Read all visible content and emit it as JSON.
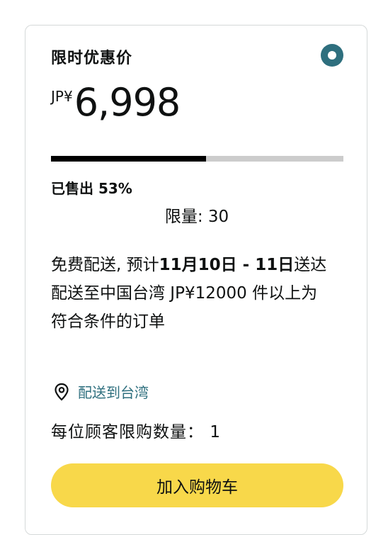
{
  "offer": {
    "title": "限时优惠价",
    "selected": true,
    "currency": "JP¥",
    "price": "6,998",
    "sold_percent": 53,
    "sold_label": "已售出 53%",
    "limit_label": "限量: 30"
  },
  "delivery": {
    "prefix": "免费配送, 预计",
    "date_range": "11月10日 - 11日",
    "suffix": "送达 配送至中国台湾 JP¥12000 件以上为 符合条件的订单"
  },
  "location": {
    "icon": "location-pin-icon",
    "label": "配送到台湾"
  },
  "quantity": {
    "label": "每位顾客限购数量：",
    "value": "1"
  },
  "cart_button": {
    "label": "加入购物车"
  },
  "colors": {
    "accent": "#2e6f7e",
    "button": "#f8d84a",
    "progress_fill": "#000000",
    "progress_track": "#cccccc"
  }
}
